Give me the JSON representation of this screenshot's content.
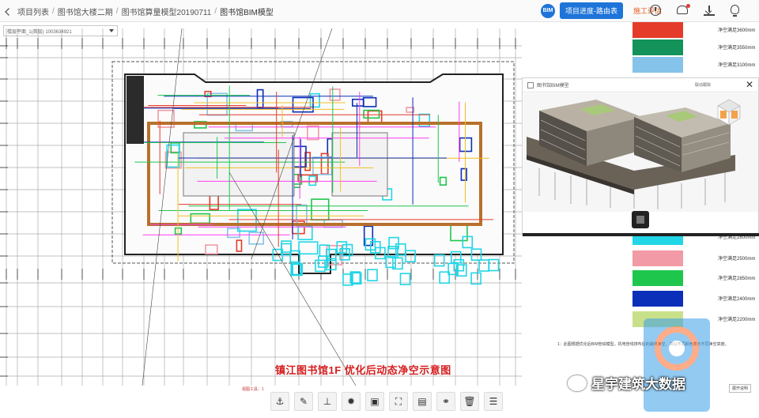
{
  "breadcrumb": {
    "items": [
      "项目列表",
      "图书馆大楼二期",
      "图书馆算量模型20190711",
      "图书馆BIM模型"
    ]
  },
  "tabs": {
    "logo_text": "BIM",
    "active_label": "项目进度-路由表",
    "inactive_label": "施工评估"
  },
  "icons": {
    "top": [
      "clock-icon",
      "bell-icon",
      "download-icon",
      "bulb-icon"
    ]
  },
  "floor_select": {
    "value": "楼层平面_1(首层) 1003634921"
  },
  "caption": "镇江图书馆1F 优化后动态净空示意图",
  "toolbar": {
    "label": "视图工具：1"
  },
  "legend": {
    "items": [
      {
        "label": "净空满足3600mm",
        "color": "#e53b2a"
      },
      {
        "label": "净空满足3550mm",
        "color": "#13935a"
      },
      {
        "label": "净空满足3100mm",
        "color": "#86c3ea"
      },
      {
        "label": "净空满足2800mm",
        "color": "#21d6e6"
      },
      {
        "label": "净空满足2500mm",
        "color": "#f29aa5"
      },
      {
        "label": "净空满足2850mm",
        "color": "#1fc64c"
      },
      {
        "label": "净空满足2400mm",
        "color": "#0b2fb9"
      },
      {
        "label": "净空满足2200mm",
        "color": "#c9e08a"
      }
    ]
  },
  "model_popup": {
    "title": "图书馆BIM模型",
    "linkage": "联动跟踪",
    "close": "✕"
  },
  "notes": {
    "line1": "1：此图根据优化后BIM管综模型，机电管线排布后的最终净空，并以不同颜色表示不同净空高度。",
    "expand": "展开说明"
  },
  "watermark": "星宇建筑大数据"
}
